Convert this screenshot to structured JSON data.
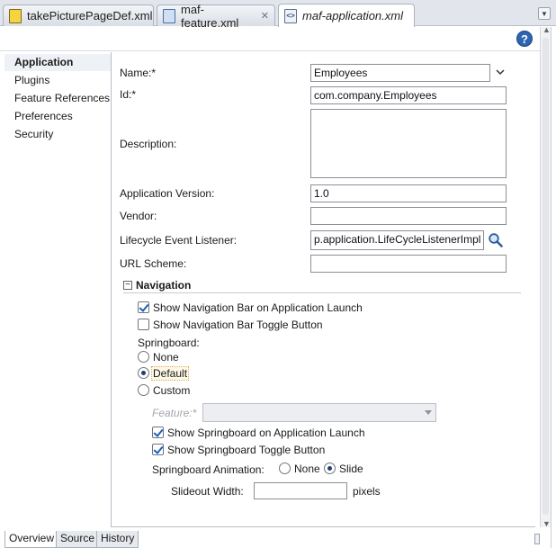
{
  "tabs": [
    {
      "label": "takePicturePageDef.xml",
      "icon": "pagedef-file-icon",
      "active": false
    },
    {
      "label": "maf-feature.xml",
      "icon": "feature-file-icon",
      "active": false
    },
    {
      "label": "maf-application.xml",
      "icon": "xml-file-icon",
      "active": true
    }
  ],
  "help_label": "?",
  "nav": {
    "items": [
      {
        "label": "Application",
        "selected": true
      },
      {
        "label": "Plugins",
        "selected": false
      },
      {
        "label": "Feature References",
        "selected": false
      },
      {
        "label": "Preferences",
        "selected": false
      },
      {
        "label": "Security",
        "selected": false
      }
    ]
  },
  "form": {
    "name": {
      "label": "Name:*",
      "value": "Employees"
    },
    "id": {
      "label": "Id:*",
      "value": "com.company.Employees"
    },
    "description": {
      "label": "Description:",
      "value": ""
    },
    "version": {
      "label": "Application Version:",
      "value": "1.0"
    },
    "vendor": {
      "label": "Vendor:",
      "value": ""
    },
    "lifecycle": {
      "label": "Lifecycle Event Listener:",
      "value": "p.application.LifeCycleListenerImpl"
    },
    "url_scheme": {
      "label": "URL Scheme:",
      "value": ""
    }
  },
  "navigation": {
    "section_title": "Navigation",
    "collapse_glyph": "−",
    "show_nav_bar": {
      "label": "Show Navigation Bar on Application Launch",
      "checked": true
    },
    "show_nav_toggle": {
      "label": "Show Navigation Bar Toggle Button",
      "checked": false
    },
    "springboard_label": "Springboard:",
    "springboard_options": [
      {
        "label": "None",
        "selected": false
      },
      {
        "label": "Default",
        "selected": true
      },
      {
        "label": "Custom",
        "selected": false
      }
    ],
    "feature_label": "Feature:*",
    "feature_value": "",
    "show_springboard_launch": {
      "label": "Show Springboard on Application Launch",
      "checked": true
    },
    "show_springboard_toggle": {
      "label": "Show Springboard Toggle Button",
      "checked": true
    },
    "animation_label": "Springboard Animation:",
    "animation_options": [
      {
        "label": "None",
        "selected": false
      },
      {
        "label": "Slide",
        "selected": true
      }
    ],
    "slideout_label": "Slideout Width:",
    "slideout_value": "",
    "slideout_unit": "pixels"
  },
  "bottom_tabs": [
    {
      "label": "Overview",
      "active": true
    },
    {
      "label": "Source",
      "active": false
    },
    {
      "label": "History",
      "active": false
    }
  ],
  "colors": {
    "accent": "#2f64b3",
    "check": "#1c5fb8",
    "focus": "#d6b35a"
  }
}
